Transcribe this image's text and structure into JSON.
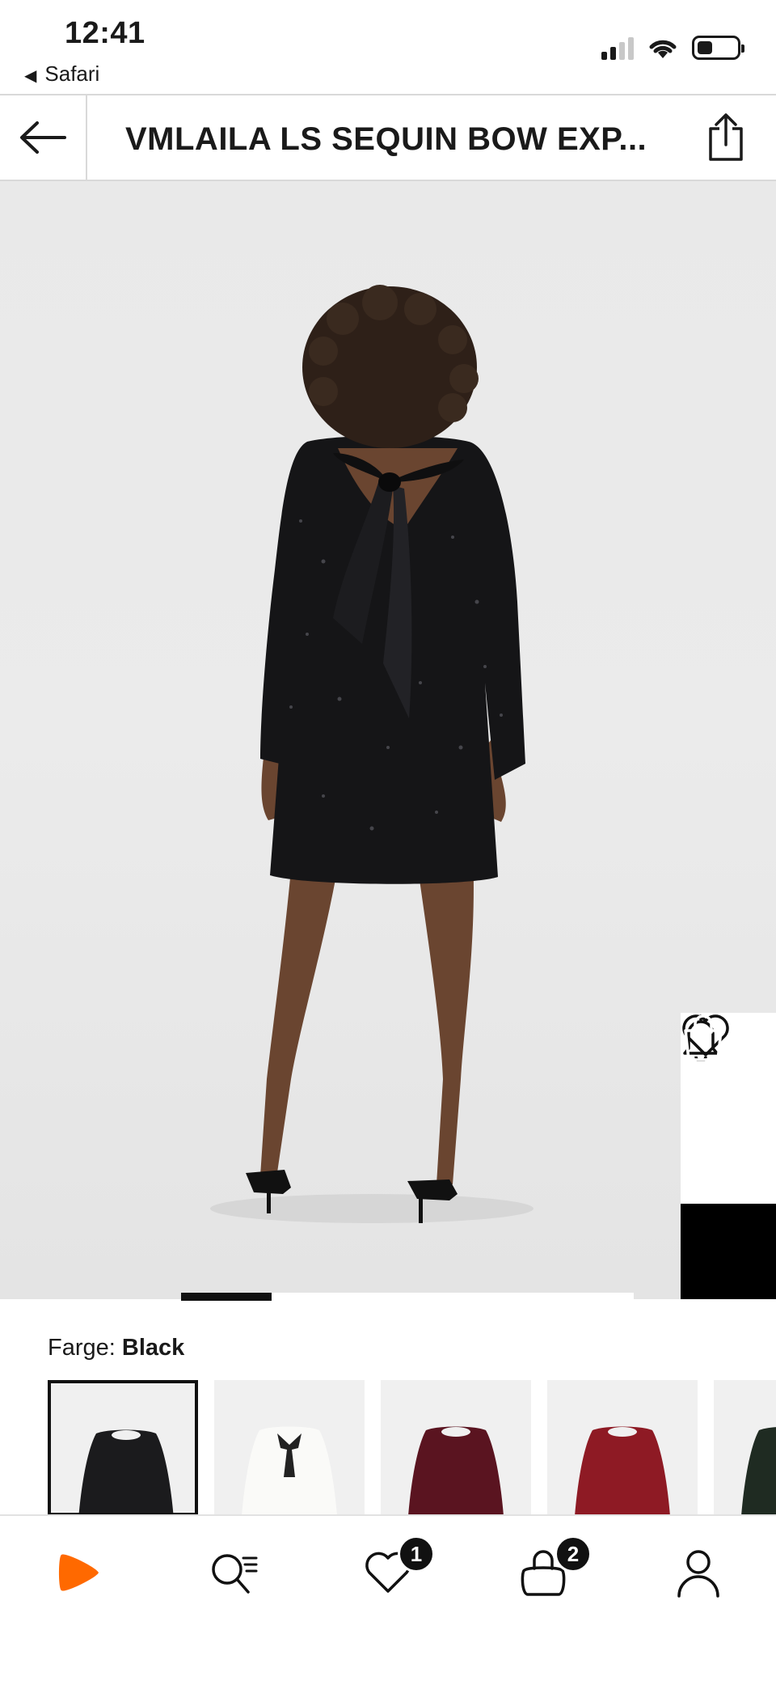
{
  "status_bar": {
    "time": "12:41",
    "back_app": "Safari",
    "icons": [
      "cellular-signal-icon",
      "wifi-icon",
      "battery-icon"
    ]
  },
  "header": {
    "back_icon": "arrow-left-icon",
    "title": "VMLAILA LS SEQUIN BOW EXP...",
    "share_icon": "share-icon"
  },
  "hero": {
    "image": "model-back-view-black-sequin-dress-with-satin-bow",
    "actions": {
      "ai_icon": "sparkle-chat-icon",
      "notify_icon": "bell-icon",
      "wishlist_icon": "heart-icon",
      "bag_icon": "shopping-bag-icon"
    },
    "gallery_position": {
      "current": 1,
      "segments": 5
    }
  },
  "color": {
    "label": "Farge:",
    "selected": "Black",
    "swatches": [
      {
        "name": "black",
        "color": "#1b1b1d",
        "selected": true
      },
      {
        "name": "white-with-black-bow",
        "color": "#f2f2ef",
        "selected": false
      },
      {
        "name": "burgundy-sequin",
        "color": "#5a1420",
        "selected": false
      },
      {
        "name": "red",
        "color": "#8e1a24",
        "selected": false
      },
      {
        "name": "dark-green",
        "color": "#1f2b22",
        "selected": false
      }
    ]
  },
  "bottom_nav": {
    "items": [
      {
        "icon": "zalando-logo-icon",
        "badge": ""
      },
      {
        "icon": "search-icon",
        "badge": ""
      },
      {
        "icon": "heart-icon",
        "badge": "1"
      },
      {
        "icon": "bag-icon",
        "badge": "2"
      },
      {
        "icon": "user-icon",
        "badge": ""
      }
    ],
    "accent": "#ff6900"
  }
}
